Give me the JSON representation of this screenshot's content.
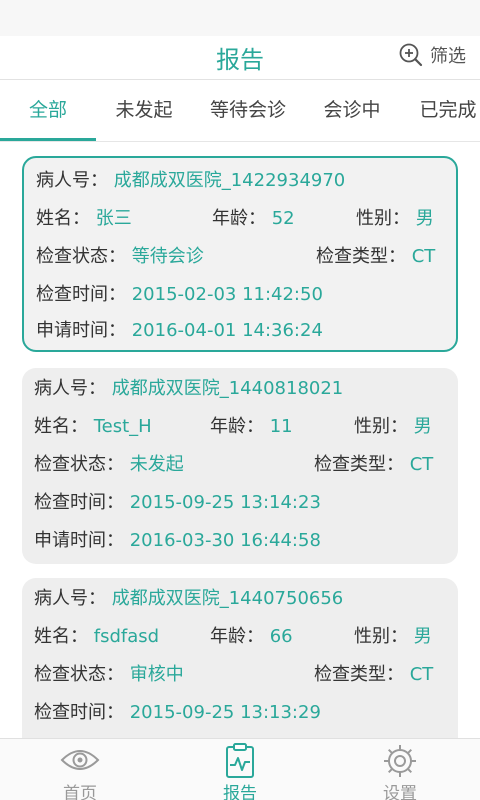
{
  "header": {
    "title": "报告",
    "filter_label": "筛选"
  },
  "tabs": [
    {
      "label": "全部",
      "active": true
    },
    {
      "label": "未发起",
      "active": false
    },
    {
      "label": "等待会诊",
      "active": false
    },
    {
      "label": "会诊中",
      "active": false
    },
    {
      "label": "已完成",
      "active": false
    }
  ],
  "labels": {
    "patient_id": "病人号：",
    "name": "姓名：",
    "age": "年龄：",
    "gender": "性别：",
    "status": "检查状态：",
    "exam_type": "检查类型：",
    "exam_time": "检查时间：",
    "apply_time": "申请时间："
  },
  "reports": [
    {
      "patient_id": "成都成双医院_1422934970",
      "name": "张三",
      "age": "52",
      "gender": "男",
      "status": "等待会诊",
      "exam_type": "CT",
      "exam_time": "2015-02-03 11:42:50",
      "apply_time": "2016-04-01 14:36:24"
    },
    {
      "patient_id": "成都成双医院_1440818021",
      "name": "Test_H",
      "age": "11",
      "gender": "男",
      "status": "未发起",
      "exam_type": "CT",
      "exam_time": "2015-09-25 13:14:23",
      "apply_time": "2016-03-30 16:44:58"
    },
    {
      "patient_id": "成都成双医院_1440750656",
      "name": "fsdfasd",
      "age": "66",
      "gender": "男",
      "status": "审核中",
      "exam_type": "CT",
      "exam_time": "2015-09-25 13:13:29",
      "apply_time": ""
    }
  ],
  "bottom_nav": [
    {
      "label": "首页",
      "icon": "eye-icon",
      "active": false
    },
    {
      "label": "报告",
      "icon": "report-icon",
      "active": true
    },
    {
      "label": "设置",
      "icon": "gear-icon",
      "active": false
    }
  ],
  "colors": {
    "accent": "#2aa89a",
    "card_bg": "#eeeeee",
    "text": "#333333"
  }
}
